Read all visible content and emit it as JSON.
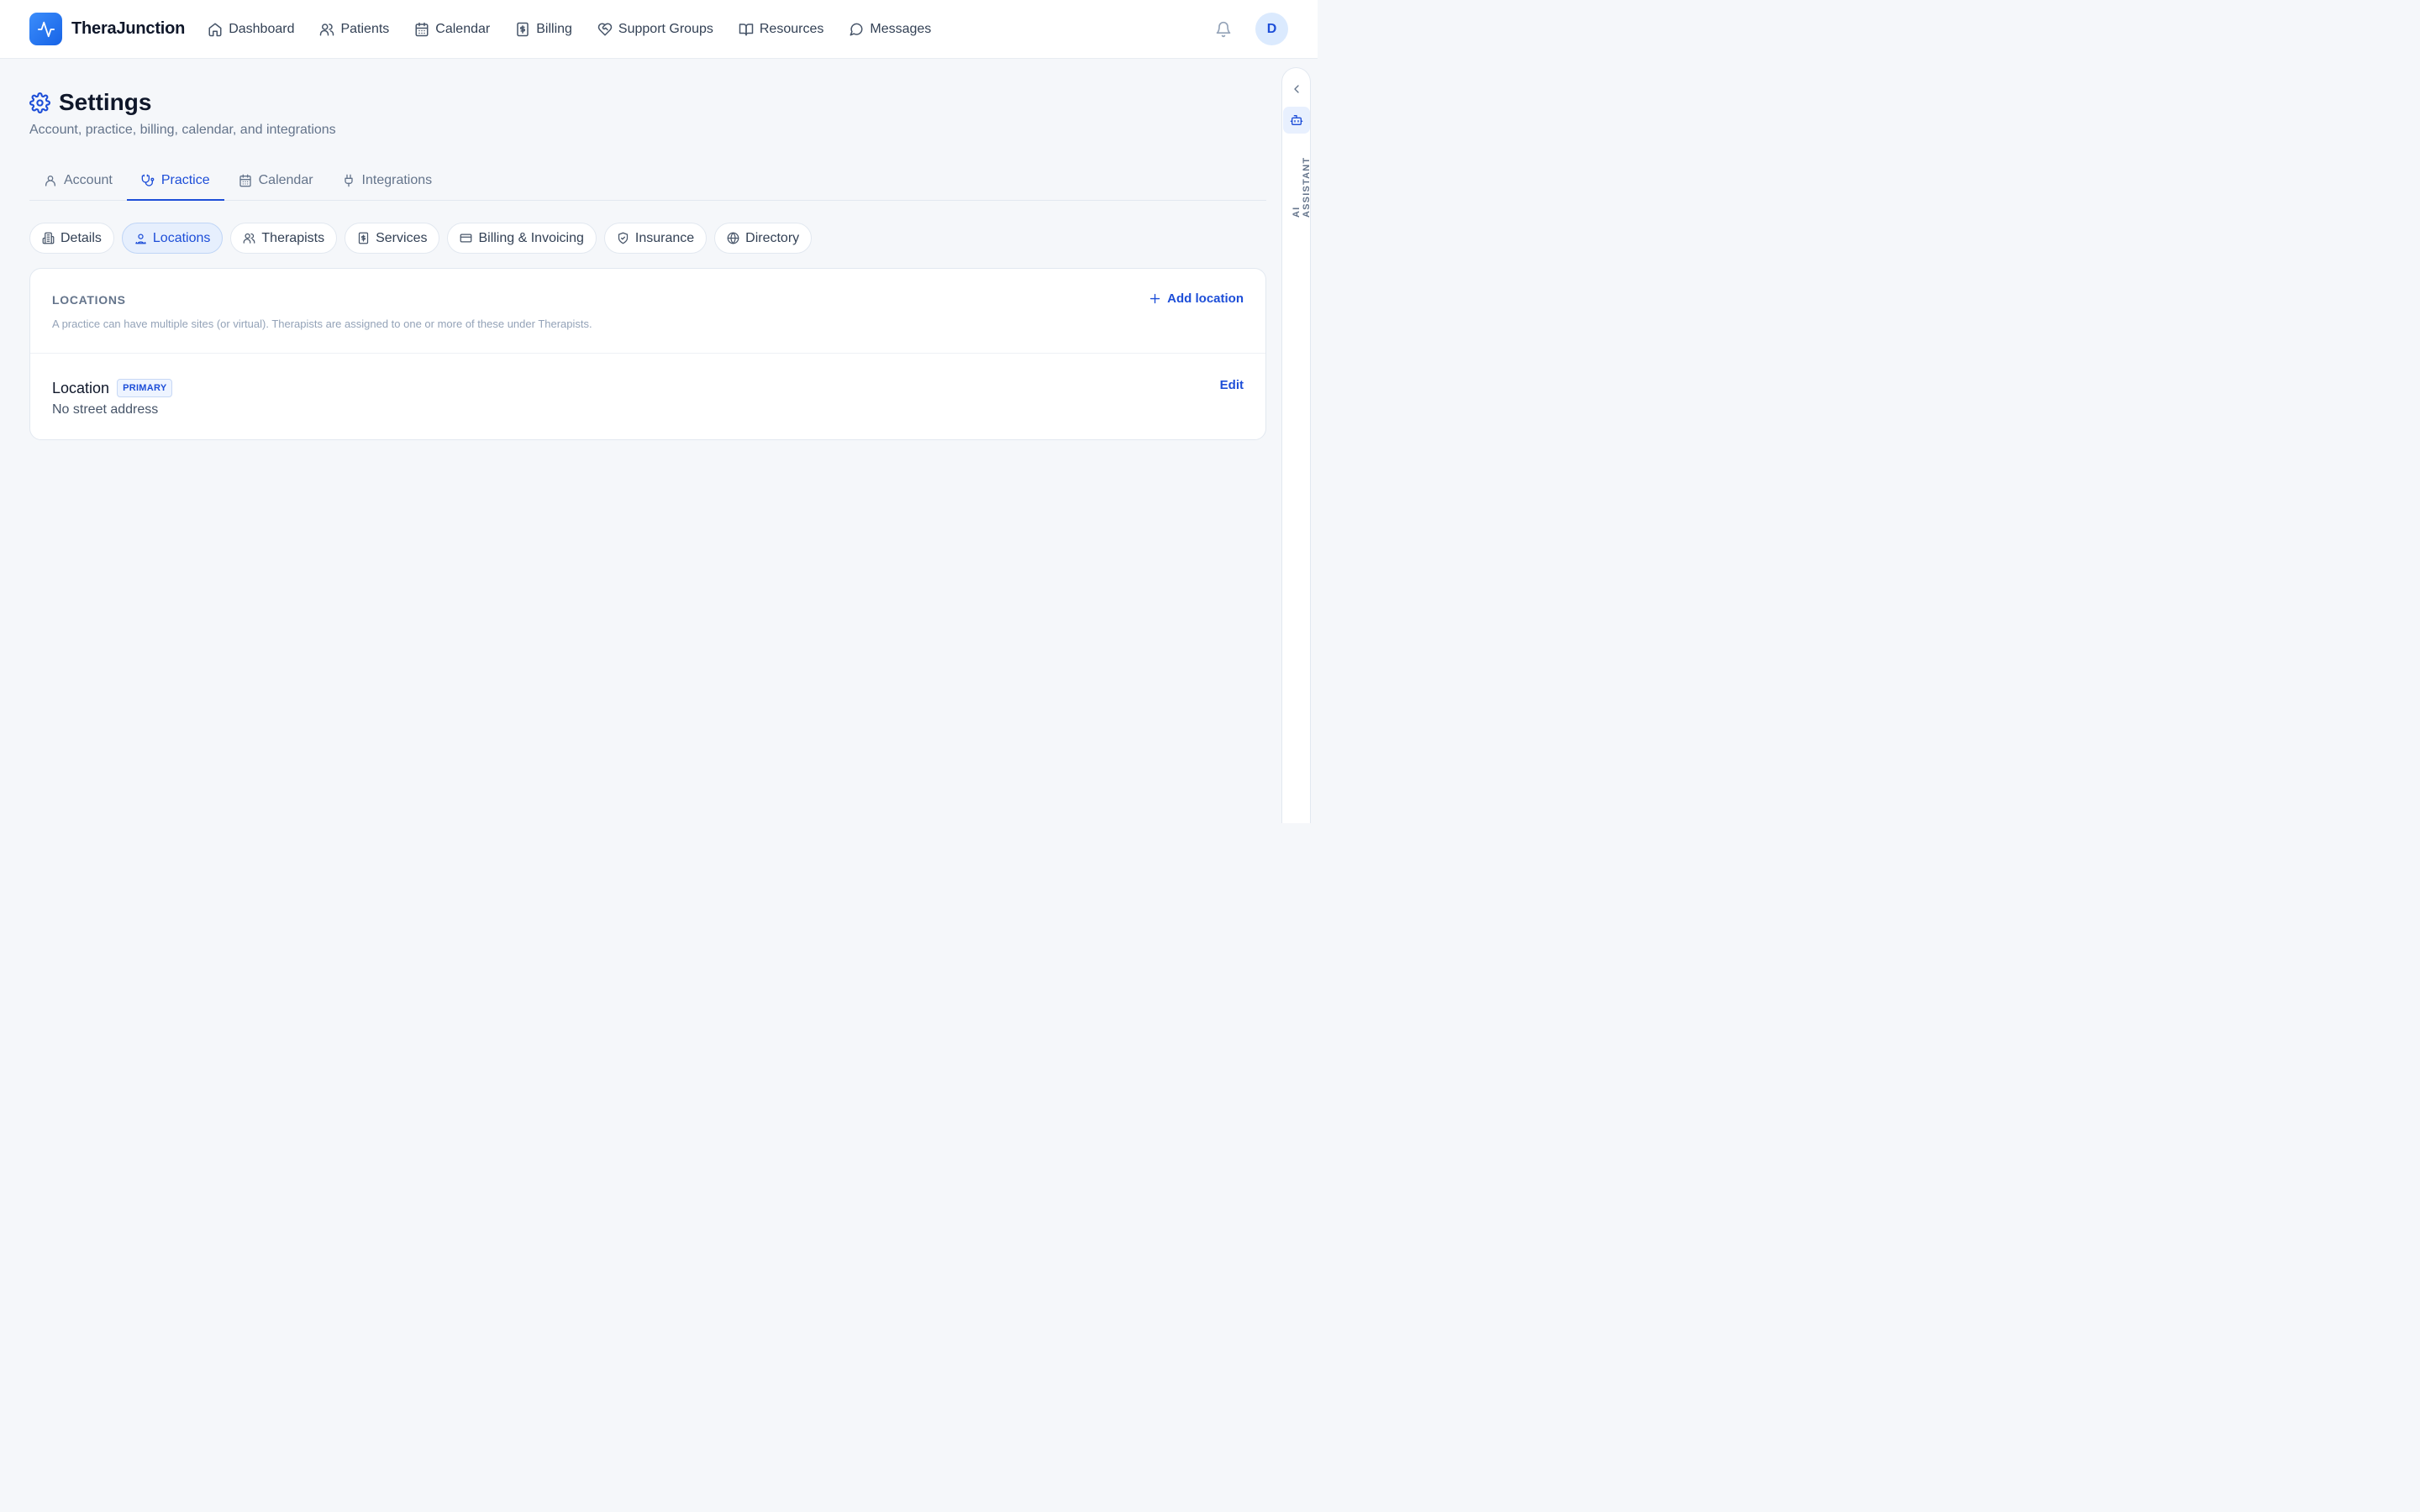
{
  "brand": {
    "name": "TheraJunction",
    "icon": "activity-icon"
  },
  "nav": [
    {
      "label": "Dashboard",
      "icon": "home-icon"
    },
    {
      "label": "Patients",
      "icon": "users-icon"
    },
    {
      "label": "Calendar",
      "icon": "calendar-icon"
    },
    {
      "label": "Billing",
      "icon": "receipt-icon"
    },
    {
      "label": "Support Groups",
      "icon": "heart-handshake-icon"
    },
    {
      "label": "Resources",
      "icon": "book-open-icon"
    },
    {
      "label": "Messages",
      "icon": "message-circle-icon"
    }
  ],
  "header_right": {
    "avatar_initial": "D",
    "notifications_icon": "bell-icon"
  },
  "page": {
    "title": "Settings",
    "subtitle": "Account, practice, billing, calendar, and integrations",
    "icon": "gear-icon"
  },
  "tabs": [
    {
      "label": "Account",
      "icon": "user-icon",
      "active": false
    },
    {
      "label": "Practice",
      "icon": "stethoscope-icon",
      "active": true
    },
    {
      "label": "Calendar",
      "icon": "calendar-icon",
      "active": false
    },
    {
      "label": "Integrations",
      "icon": "plug-icon",
      "active": false
    }
  ],
  "subtabs": [
    {
      "label": "Details",
      "icon": "building-icon",
      "active": false
    },
    {
      "label": "Locations",
      "icon": "map-pin-user-icon",
      "active": true
    },
    {
      "label": "Therapists",
      "icon": "users-icon",
      "active": false
    },
    {
      "label": "Services",
      "icon": "receipt-icon",
      "active": false
    },
    {
      "label": "Billing & Invoicing",
      "icon": "credit-card-icon",
      "active": false
    },
    {
      "label": "Insurance",
      "icon": "shield-check-icon",
      "active": false
    },
    {
      "label": "Directory",
      "icon": "globe-icon",
      "active": false
    }
  ],
  "locations_card": {
    "title": "LOCATIONS",
    "description": "A practice can have multiple sites (or virtual). Therapists are assigned to one or more of these under Therapists.",
    "add_label": "Add location",
    "items": [
      {
        "name": "Location",
        "badge": "PRIMARY",
        "address": "No street address",
        "edit_label": "Edit"
      }
    ]
  },
  "ai_panel": {
    "label": "AI ASSISTANT"
  },
  "colors": {
    "accent": "#1d4ed8",
    "brand_gradient_start": "#3b8dfb",
    "brand_gradient_end": "#1763e6",
    "background": "#f5f7fa"
  }
}
